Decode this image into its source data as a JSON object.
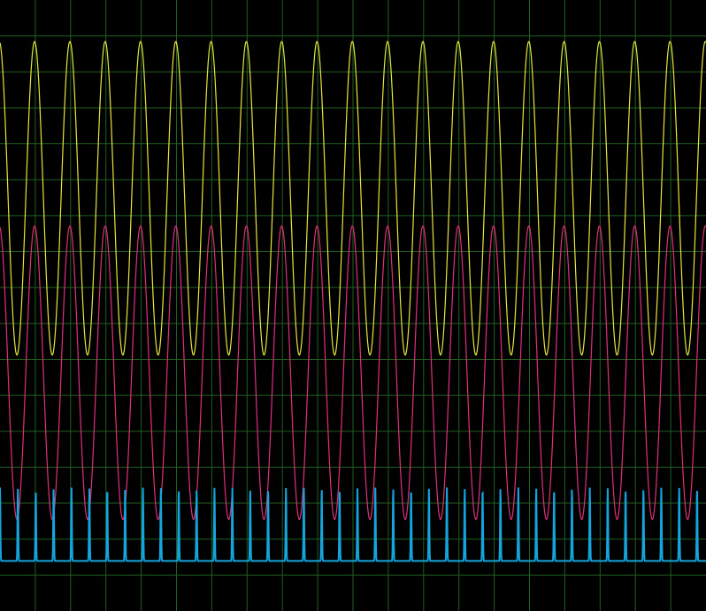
{
  "chart_data": {
    "type": "line",
    "grid": true,
    "colors": {
      "background": "#000000",
      "grid": "#1f5f1f",
      "yellow": "#e6e63c",
      "pink": "#e0307a",
      "cyan": "#14a5dc",
      "cyan_baseline": "#14a5dc"
    },
    "grid_divisions": {
      "x": 20,
      "y": 17
    },
    "series": [
      {
        "key": "yellow",
        "shape": "sine",
        "cycles": 20,
        "phase_cycles": 0.02,
        "high": 0.068,
        "low": 0.581
      },
      {
        "key": "pink",
        "shape": "sine",
        "cycles": 20,
        "phase_cycles": 0.02,
        "high": 0.37,
        "low": 0.85
      },
      {
        "key": "cyan",
        "shape": "pulse",
        "cycles": 39.5,
        "phase_cycles": 0.0,
        "high": 0.798,
        "low": 0.918
      }
    ]
  }
}
